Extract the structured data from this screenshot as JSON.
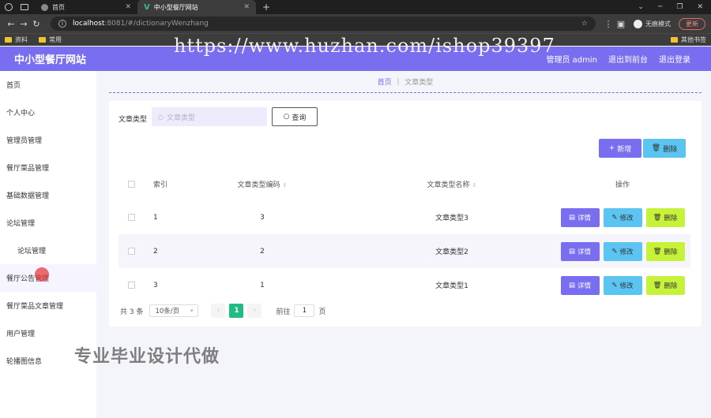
{
  "browser": {
    "tabs": [
      {
        "label": "首页"
      },
      {
        "label": "中小型餐厅网站"
      }
    ],
    "new_tab": "+",
    "address": {
      "host": "localhost",
      "path": ":8081/#/dictionaryWenzhang"
    },
    "incognito": "无痕模式",
    "update": "更新",
    "bookmarks": [
      "资料",
      "常用"
    ],
    "bookmarks_right": "其他书签"
  },
  "header": {
    "site_title": "中小型餐厅网站",
    "user": "管理员 admin",
    "to_front": "退出到前台",
    "logout": "退出登录"
  },
  "sidebar": {
    "items": [
      {
        "label": "首页"
      },
      {
        "label": "个人中心"
      },
      {
        "label": "管理员管理"
      },
      {
        "label": "餐厅菜品管理"
      },
      {
        "label": "基础数据管理"
      },
      {
        "label": "论坛管理"
      },
      {
        "label": "论坛管理"
      },
      {
        "label": "餐厅公告管理"
      },
      {
        "label": "餐厅菜品文章管理"
      },
      {
        "label": "用户管理"
      },
      {
        "label": "轮播图信息"
      }
    ]
  },
  "breadcrumb": {
    "home": "首页",
    "current": "文章类型"
  },
  "search": {
    "label": "文章类型",
    "placeholder": "文章类型",
    "button": "查询"
  },
  "actions": {
    "add": "新增",
    "delete": "删除"
  },
  "table": {
    "headers": {
      "index": "索引",
      "code": "文章类型编码",
      "name": "文章类型名称",
      "ops": "操作"
    },
    "rows": [
      {
        "index": "1",
        "code": "3",
        "name": "文章类型3"
      },
      {
        "index": "2",
        "code": "2",
        "name": "文章类型2"
      },
      {
        "index": "3",
        "code": "1",
        "name": "文章类型1"
      }
    ],
    "op_labels": {
      "detail": "详情",
      "edit": "修改",
      "remove": "删除"
    }
  },
  "pagination": {
    "total": "共 3 条",
    "page_size": "10条/页",
    "current_page": "1",
    "goto_prefix": "前往",
    "goto_value": "1",
    "goto_suffix": "页"
  },
  "watermarks": {
    "url": "https://www.huzhan.com/ishop39397",
    "text": "专业毕业设计代做"
  },
  "colors": {
    "primary": "#7a6ef0",
    "info": "#5bc4f0",
    "lime": "#c6f23a",
    "pager_active": "#1fbd84"
  }
}
